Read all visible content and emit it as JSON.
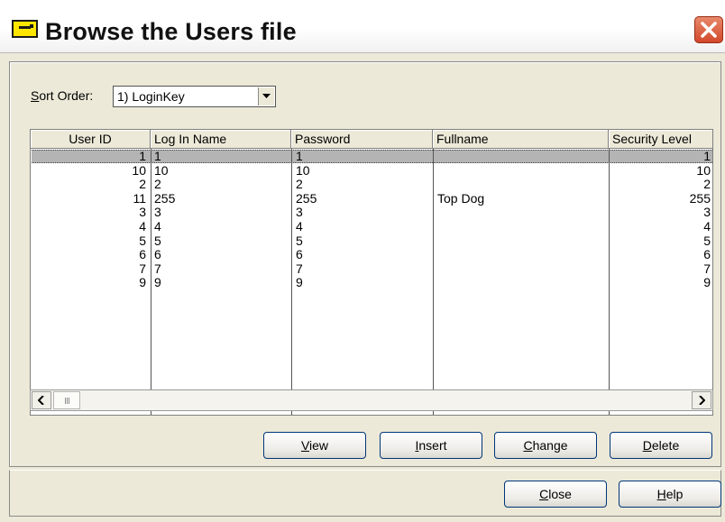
{
  "window": {
    "title": "Browse the Users file"
  },
  "sort": {
    "label_accel": "S",
    "label_rest": "ort Order:",
    "selected": "1) LoginKey"
  },
  "table": {
    "columns": [
      "User ID",
      "Log In Name",
      "Password",
      "Fullname",
      "Security Level"
    ],
    "rows": [
      [
        "1",
        "1",
        "1",
        "",
        "1"
      ],
      [
        "10",
        "10",
        "10",
        "",
        "10"
      ],
      [
        "2",
        "2",
        "2",
        "",
        "2"
      ],
      [
        "11",
        "255",
        "255",
        "Top Dog",
        "255"
      ],
      [
        "3",
        "3",
        "3",
        "",
        "3"
      ],
      [
        "4",
        "4",
        "4",
        "",
        "4"
      ],
      [
        "5",
        "5",
        "5",
        "",
        "5"
      ],
      [
        "6",
        "6",
        "6",
        "",
        "6"
      ],
      [
        "7",
        "7",
        "7",
        "",
        "7"
      ],
      [
        "9",
        "9",
        "9",
        "",
        "9"
      ]
    ],
    "selected_row": 0
  },
  "buttons": {
    "view": {
      "accel": "V",
      "rest": "iew"
    },
    "insert": {
      "accel": "I",
      "rest": "nsert"
    },
    "change": {
      "accel": "C",
      "rest": "hange"
    },
    "delete": {
      "accel": "D",
      "rest": "elete"
    },
    "close": {
      "accel": "C",
      "rest": "lose"
    },
    "help": {
      "accel": "H",
      "rest": "elp"
    }
  },
  "icons": {
    "app": "window-icon",
    "close": "close-icon",
    "dropdown": "chevron-down-icon",
    "scroll_left": "arrow-left-icon",
    "scroll_right": "arrow-right-icon"
  },
  "colors": {
    "close_button": "#d2482b",
    "selection": "#b4b4b4",
    "app_icon": "#ffe600"
  }
}
